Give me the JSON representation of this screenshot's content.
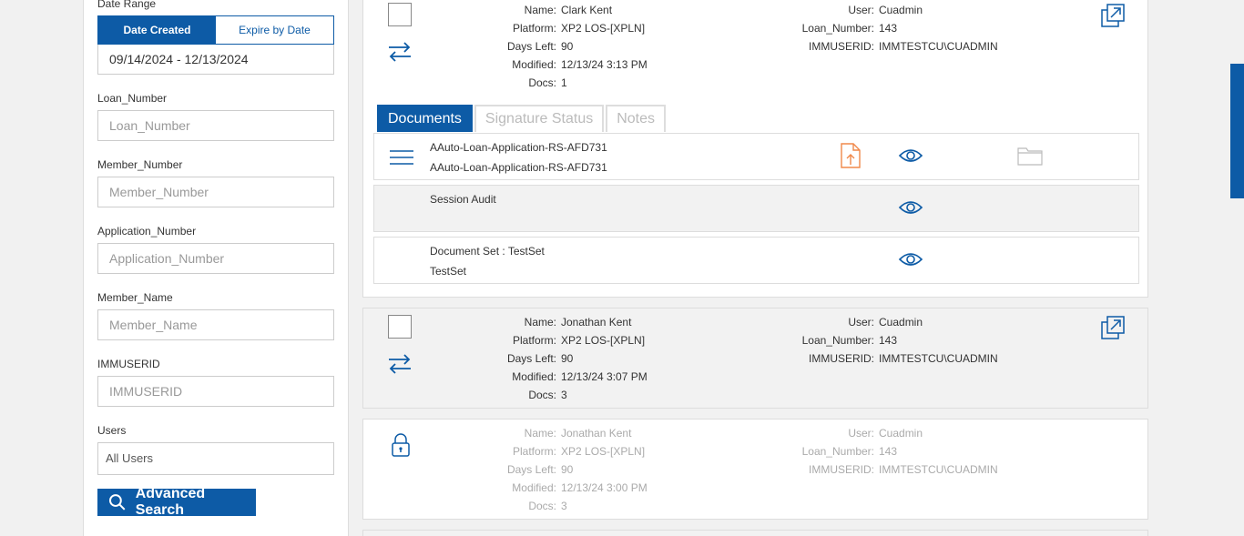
{
  "sidebar": {
    "date_range_label": "Date Range",
    "toggle_created": "Date Created",
    "toggle_expire": "Expire by Date",
    "date_range_value": "09/14/2024 - 12/13/2024",
    "loan_number_label": "Loan_Number",
    "loan_number_placeholder": "Loan_Number",
    "member_number_label": "Member_Number",
    "member_number_placeholder": "Member_Number",
    "application_number_label": "Application_Number",
    "application_number_placeholder": "Application_Number",
    "member_name_label": "Member_Name",
    "member_name_placeholder": "Member_Name",
    "immuserid_label": "IMMUSERID",
    "immuserid_placeholder": "IMMUSERID",
    "users_label": "Users",
    "users_value": "All Users",
    "advanced_search_label": "Advanced Search"
  },
  "cards": [
    {
      "name_k": "Name:",
      "name_v": "Clark Kent",
      "platform_k": "Platform:",
      "platform_v": "XP2 LOS-[XPLN]",
      "days_k": "Days Left:",
      "days_v": "90",
      "modified_k": "Modified:",
      "modified_v": "12/13/24 3:13 PM",
      "docs_k": "Docs:",
      "docs_v": "1",
      "user_k": "User:",
      "user_v": "Cuadmin",
      "loan_k": "Loan_Number:",
      "loan_v": "143",
      "imm_k": "IMMUSERID:",
      "imm_v": "IMMTESTCU\\CUADMIN",
      "tabs": [
        "Documents",
        "Signature Status",
        "Notes"
      ],
      "documents": [
        {
          "line1": "AAuto-Loan-Application-RS-AFD731",
          "line2": "AAuto-Loan-Application-RS-AFD731"
        },
        {
          "line1": "Session Audit"
        },
        {
          "line1": "Document Set : TestSet",
          "line2": "TestSet"
        }
      ]
    },
    {
      "name_k": "Name:",
      "name_v": "Jonathan Kent",
      "platform_k": "Platform:",
      "platform_v": "XP2 LOS-[XPLN]",
      "days_k": "Days Left:",
      "days_v": "90",
      "modified_k": "Modified:",
      "modified_v": "12/13/24 3:07 PM",
      "docs_k": "Docs:",
      "docs_v": "3",
      "user_k": "User:",
      "user_v": "Cuadmin",
      "loan_k": "Loan_Number:",
      "loan_v": "143",
      "imm_k": "IMMUSERID:",
      "imm_v": "IMMTESTCU\\CUADMIN"
    },
    {
      "name_k": "Name:",
      "name_v": "Jonathan Kent",
      "platform_k": "Platform:",
      "platform_v": "XP2 LOS-[XPLN]",
      "days_k": "Days Left:",
      "days_v": "90",
      "modified_k": "Modified:",
      "modified_v": "12/13/24 3:00 PM",
      "docs_k": "Docs:",
      "docs_v": "3",
      "user_k": "User:",
      "user_v": "Cuadmin",
      "loan_k": "Loan_Number:",
      "loan_v": "143",
      "imm_k": "IMMUSERID:",
      "imm_v": "IMMTESTCU\\CUADMIN"
    }
  ],
  "colors": {
    "accent": "#0d5ba6",
    "upload_orange": "#f0884a"
  }
}
